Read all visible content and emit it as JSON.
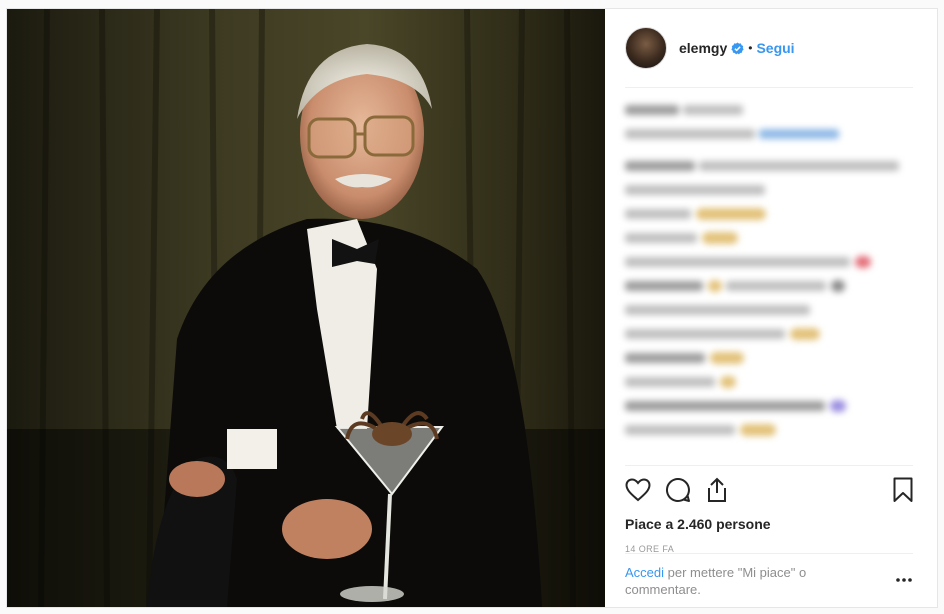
{
  "post": {
    "image_alt": "Portrait of elderly man in tuxedo holding martini glass with a spider",
    "author": {
      "username": "elemgy",
      "verified": true,
      "follow_label": "Segui",
      "separator": "•"
    },
    "comments_blurred": true,
    "likes_text": "Piace a 2.460 persone",
    "timestamp": "14 ORE FA",
    "login_prompt": {
      "link": "Accedi",
      "text": " per mettere \"Mi piace\" o commentare."
    },
    "icons": [
      "heart-icon",
      "comment-icon",
      "share-icon",
      "bookmark-icon",
      "more-options-icon"
    ]
  },
  "colors": {
    "accent": "#3897f0",
    "text": "#262626",
    "muted": "#999999",
    "border": "#efefef"
  }
}
